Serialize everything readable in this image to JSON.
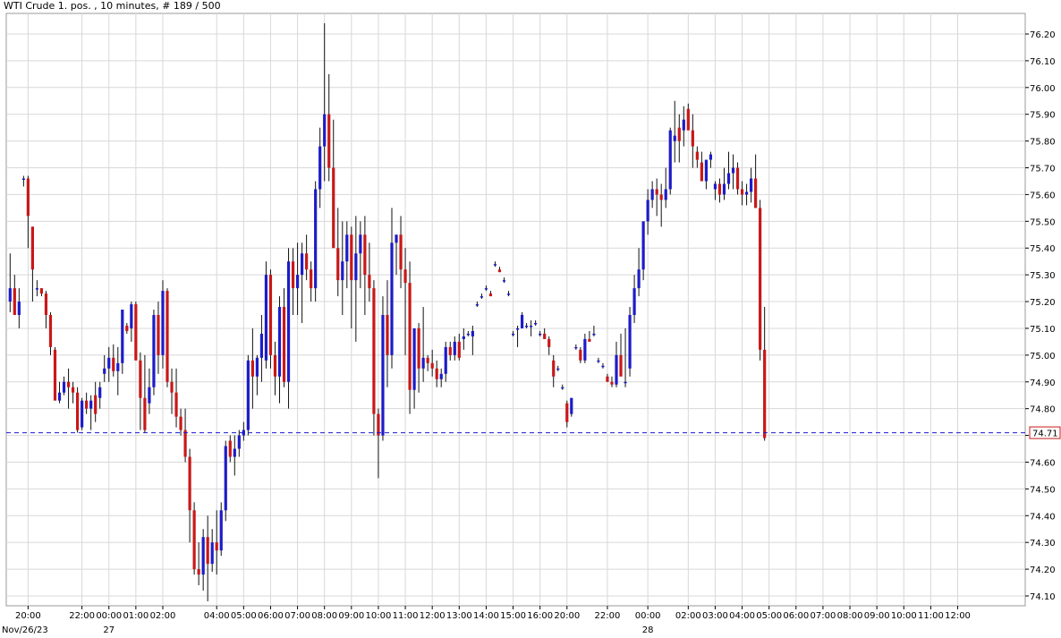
{
  "title": "WTI Crude 1. pos. , 10 minutes, # 189 / 500",
  "colors": {
    "up": "#1c1cc8",
    "down": "#c81818",
    "grid": "#d8d8d8",
    "current_line": "#1a1ad0"
  },
  "chart_data": {
    "type": "candlestick",
    "instrument": "WTI Crude 1. pos.",
    "interval": "10 minutes",
    "y_ticks": [
      74.1,
      74.2,
      74.3,
      74.4,
      74.5,
      74.6,
      74.7,
      74.8,
      74.9,
      75.0,
      75.1,
      75.2,
      75.3,
      75.4,
      75.5,
      75.6,
      75.7,
      75.8,
      75.9,
      76.0,
      76.1,
      76.2
    ],
    "y_tick_labels": [
      "74.10",
      "74.20",
      "74.30",
      "74.40",
      "74.50",
      "74.60",
      "74.70",
      "74.80",
      "74.90",
      "75.00",
      "75.10",
      "75.20",
      "75.30",
      "75.40",
      "75.50",
      "75.60",
      "75.70",
      "75.80",
      "75.90",
      "76.00",
      "76.10",
      "76.20"
    ],
    "ylim": [
      74.06,
      76.28
    ],
    "current_price": 74.71,
    "current_price_label": "74.71",
    "x_ticks": [
      {
        "i": 4,
        "label": "20:00"
      },
      {
        "i": 16,
        "label": "22:00"
      },
      {
        "i": 22,
        "label": "00:00"
      },
      {
        "i": 28,
        "label": "01:00"
      },
      {
        "i": 34,
        "label": "02:00"
      },
      {
        "i": 46,
        "label": "04:00"
      },
      {
        "i": 52,
        "label": "05:00"
      },
      {
        "i": 58,
        "label": "06:00"
      },
      {
        "i": 64,
        "label": "07:00"
      },
      {
        "i": 70,
        "label": "08:00"
      },
      {
        "i": 76,
        "label": "09:00"
      },
      {
        "i": 82,
        "label": "10:00"
      },
      {
        "i": 88,
        "label": "11:00"
      },
      {
        "i": 94,
        "label": "12:00"
      },
      {
        "i": 100,
        "label": "13:00"
      },
      {
        "i": 106,
        "label": "14:00"
      },
      {
        "i": 112,
        "label": "15:00"
      },
      {
        "i": 118,
        "label": "16:00"
      },
      {
        "i": 124,
        "label": "20:00"
      },
      {
        "i": 133,
        "label": "22:00"
      },
      {
        "i": 142,
        "label": "00:00"
      },
      {
        "i": 151,
        "label": "02:00"
      },
      {
        "i": 157,
        "label": "03:00"
      },
      {
        "i": 163,
        "label": "04:00"
      },
      {
        "i": 169,
        "label": "05:00"
      },
      {
        "i": 175,
        "label": "06:00"
      },
      {
        "i": 181,
        "label": "07:00"
      },
      {
        "i": 187,
        "label": "08:00"
      },
      {
        "i": 193,
        "label": "09:00"
      },
      {
        "i": 199,
        "label": "10:00"
      },
      {
        "i": 205,
        "label": "11:00"
      },
      {
        "i": 211,
        "label": "12:00"
      }
    ],
    "date_labels": [
      {
        "i": 0,
        "label": "Nov/26/23"
      },
      {
        "i": 22,
        "label": "27"
      },
      {
        "i": 142,
        "label": "28"
      }
    ],
    "ohlc": [
      [
        75.2,
        75.38,
        75.16,
        75.25
      ],
      [
        75.25,
        75.3,
        75.15,
        75.15
      ],
      [
        75.15,
        75.25,
        75.1,
        75.2
      ],
      [
        75.66,
        75.67,
        75.63,
        75.66
      ],
      [
        75.66,
        75.67,
        75.4,
        75.52
      ],
      [
        75.48,
        75.48,
        75.2,
        75.32
      ],
      [
        75.25,
        75.28,
        75.22,
        75.25
      ],
      [
        75.25,
        75.25,
        75.22,
        75.23
      ],
      [
        75.23,
        75.24,
        75.1,
        75.15
      ],
      [
        75.15,
        75.16,
        75.0,
        75.03
      ],
      [
        75.02,
        75.03,
        74.87,
        74.83
      ],
      [
        74.83,
        74.9,
        74.82,
        74.86
      ],
      [
        74.86,
        74.92,
        74.85,
        74.9
      ],
      [
        74.9,
        74.95,
        74.8,
        74.88
      ],
      [
        74.88,
        74.9,
        74.82,
        74.86
      ],
      [
        74.86,
        74.88,
        74.71,
        74.72
      ],
      [
        74.73,
        74.84,
        74.72,
        74.83
      ],
      [
        74.83,
        74.86,
        74.78,
        74.8
      ],
      [
        74.8,
        74.85,
        74.72,
        74.83
      ],
      [
        74.85,
        74.9,
        74.75,
        74.78
      ],
      [
        74.84,
        74.9,
        74.8,
        74.88
      ],
      [
        74.93,
        75.0,
        74.9,
        74.95
      ],
      [
        74.95,
        75.03,
        74.9,
        74.99
      ],
      [
        74.99,
        75.04,
        74.92,
        74.94
      ],
      [
        74.94,
        75.03,
        74.85,
        74.97
      ],
      [
        74.97,
        75.17,
        74.93,
        75.17
      ],
      [
        75.11,
        75.12,
        75.08,
        75.09
      ],
      [
        75.1,
        75.2,
        75.05,
        75.19
      ],
      [
        75.19,
        75.2,
        75.0,
        74.98
      ],
      [
        74.98,
        75.01,
        74.72,
        74.84
      ],
      [
        74.84,
        75.0,
        74.71,
        74.72
      ],
      [
        74.82,
        74.95,
        74.78,
        74.88
      ],
      [
        74.88,
        75.17,
        74.85,
        75.15
      ],
      [
        75.15,
        75.2,
        74.93,
        75.0
      ],
      [
        75.0,
        75.28,
        74.95,
        75.24
      ],
      [
        75.24,
        75.25,
        74.88,
        74.9
      ],
      [
        74.9,
        74.95,
        74.78,
        74.86
      ],
      [
        74.86,
        74.95,
        74.73,
        74.77
      ],
      [
        74.77,
        74.8,
        74.7,
        74.72
      ],
      [
        74.72,
        74.8,
        74.6,
        74.62
      ],
      [
        74.62,
        74.65,
        74.3,
        74.42
      ],
      [
        74.42,
        74.45,
        74.18,
        74.2
      ],
      [
        74.2,
        74.3,
        74.14,
        74.18
      ],
      [
        74.18,
        74.35,
        74.12,
        74.32
      ],
      [
        74.32,
        74.4,
        74.08,
        74.22
      ],
      [
        74.22,
        74.35,
        74.19,
        74.3
      ],
      [
        74.3,
        74.42,
        74.18,
        74.27
      ],
      [
        74.27,
        74.45,
        74.25,
        74.42
      ],
      [
        74.42,
        74.68,
        74.38,
        74.66
      ],
      [
        74.68,
        74.7,
        74.6,
        74.62
      ],
      [
        74.62,
        74.7,
        74.55,
        74.65
      ],
      [
        74.65,
        74.72,
        74.62,
        74.7
      ],
      [
        74.7,
        74.75,
        74.68,
        74.72
      ],
      [
        74.72,
        75.0,
        74.7,
        74.98
      ],
      [
        74.98,
        75.1,
        74.8,
        74.92
      ],
      [
        74.92,
        75.0,
        74.85,
        74.99
      ],
      [
        74.99,
        75.15,
        74.9,
        75.08
      ],
      [
        74.98,
        75.35,
        74.95,
        75.3
      ],
      [
        75.3,
        75.32,
        74.95,
        75.0
      ],
      [
        75.0,
        75.05,
        74.85,
        74.92
      ],
      [
        74.92,
        75.22,
        74.82,
        75.18
      ],
      [
        75.18,
        75.25,
        74.88,
        74.9
      ],
      [
        74.9,
        75.4,
        74.8,
        75.35
      ],
      [
        75.35,
        75.4,
        75.15,
        75.25
      ],
      [
        75.25,
        75.42,
        75.15,
        75.3
      ],
      [
        75.3,
        75.42,
        75.12,
        75.38
      ],
      [
        75.38,
        75.45,
        75.28,
        75.32
      ],
      [
        75.32,
        75.35,
        75.2,
        75.25
      ],
      [
        75.25,
        75.65,
        75.2,
        75.62
      ],
      [
        75.62,
        75.85,
        75.55,
        75.78
      ],
      [
        75.78,
        76.24,
        75.65,
        75.9
      ],
      [
        75.9,
        76.05,
        75.65,
        75.7
      ],
      [
        75.7,
        75.88,
        75.45,
        75.4
      ],
      [
        75.4,
        75.55,
        75.22,
        75.28
      ],
      [
        75.28,
        75.5,
        75.15,
        75.35
      ],
      [
        75.35,
        75.5,
        75.25,
        75.45
      ],
      [
        75.45,
        75.48,
        75.1,
        75.28
      ],
      [
        75.28,
        75.52,
        75.05,
        75.38
      ],
      [
        75.38,
        75.5,
        75.25,
        75.45
      ],
      [
        75.45,
        75.52,
        75.15,
        75.3
      ],
      [
        75.3,
        75.42,
        75.2,
        75.25
      ],
      [
        75.25,
        75.28,
        74.7,
        74.78
      ],
      [
        74.78,
        74.8,
        74.54,
        74.7
      ],
      [
        74.7,
        75.22,
        74.68,
        75.15
      ],
      [
        75.15,
        75.28,
        74.88,
        75.0
      ],
      [
        75.0,
        75.55,
        74.95,
        75.42
      ],
      [
        75.42,
        75.45,
        75.3,
        75.45
      ],
      [
        75.45,
        75.52,
        75.25,
        75.32
      ],
      [
        75.32,
        75.4,
        75.0,
        75.27
      ],
      [
        75.27,
        75.35,
        74.78,
        74.87
      ],
      [
        74.87,
        75.1,
        74.8,
        75.1
      ],
      [
        75.1,
        75.12,
        74.86,
        74.95
      ],
      [
        74.95,
        75.18,
        74.9,
        74.99
      ],
      [
        74.99,
        75.0,
        74.94,
        74.97
      ],
      [
        74.97,
        75.02,
        74.92,
        74.95
      ],
      [
        74.95,
        74.98,
        74.88,
        74.91
      ],
      [
        74.91,
        74.95,
        74.88,
        74.93
      ],
      [
        74.93,
        75.05,
        74.9,
        75.03
      ],
      [
        75.03,
        75.05,
        74.98,
        75.0
      ],
      [
        75.0,
        75.07,
        74.98,
        75.05
      ],
      [
        75.05,
        75.08,
        74.98,
        74.99
      ],
      [
        75.06,
        75.1,
        75.02,
        75.07
      ],
      [
        75.08,
        75.09,
        75.07,
        75.08
      ],
      [
        75.07,
        75.11,
        75.0,
        75.09
      ],
      [
        75.19,
        75.2,
        75.18,
        75.19
      ],
      [
        75.22,
        75.23,
        75.21,
        75.22
      ],
      [
        75.25,
        75.26,
        75.24,
        75.25
      ],
      [
        75.23,
        75.24,
        75.22,
        75.22
      ],
      [
        75.34,
        75.35,
        75.33,
        75.34
      ],
      [
        75.32,
        75.33,
        75.31,
        75.31
      ],
      [
        75.28,
        75.29,
        75.27,
        75.28
      ],
      [
        75.23,
        75.24,
        75.22,
        75.23
      ],
      [
        75.08,
        75.09,
        75.07,
        75.08
      ],
      [
        75.1,
        75.11,
        75.03,
        75.1
      ],
      [
        75.1,
        75.16,
        75.12,
        75.15
      ],
      [
        75.11,
        75.12,
        75.1,
        75.11
      ],
      [
        75.11,
        75.13,
        75.07,
        75.11
      ],
      [
        75.12,
        75.13,
        75.11,
        75.12
      ],
      [
        75.08,
        75.09,
        75.07,
        75.08
      ],
      [
        75.08,
        75.1,
        75.06,
        75.06
      ],
      [
        75.06,
        75.07,
        75.0,
        75.03
      ],
      [
        74.98,
        75.0,
        74.88,
        74.92
      ],
      [
        74.95,
        74.96,
        74.94,
        74.95
      ],
      [
        74.88,
        74.89,
        74.87,
        74.88
      ],
      [
        74.82,
        74.83,
        74.73,
        74.75
      ],
      [
        74.78,
        74.84,
        74.77,
        74.84
      ],
      [
        75.03,
        75.04,
        75.02,
        75.03
      ],
      [
        75.02,
        75.03,
        74.97,
        74.98
      ],
      [
        74.98,
        75.08,
        74.97,
        75.06
      ],
      [
        75.06,
        75.09,
        75.05,
        75.05
      ],
      [
        75.08,
        75.11,
        75.07,
        75.08
      ],
      [
        74.98,
        74.99,
        74.97,
        74.98
      ],
      [
        74.96,
        74.97,
        74.95,
        74.96
      ],
      [
        74.92,
        74.93,
        74.9,
        74.9
      ],
      [
        74.9,
        74.92,
        74.88,
        74.89
      ],
      [
        74.89,
        75.05,
        74.88,
        75.0
      ],
      [
        75.0,
        75.08,
        74.96,
        74.92
      ],
      [
        74.9,
        75.1,
        74.88,
        74.9
      ],
      [
        74.95,
        75.18,
        74.92,
        75.15
      ],
      [
        75.15,
        75.3,
        75.12,
        75.25
      ],
      [
        75.25,
        75.4,
        75.22,
        75.32
      ],
      [
        75.32,
        75.5,
        75.28,
        75.5
      ],
      [
        75.5,
        75.62,
        75.45,
        75.58
      ],
      [
        75.58,
        75.65,
        75.55,
        75.62
      ],
      [
        75.62,
        75.66,
        75.52,
        75.6
      ],
      [
        75.6,
        75.64,
        75.48,
        75.58
      ],
      [
        75.58,
        75.7,
        75.55,
        75.62
      ],
      [
        75.62,
        75.85,
        75.6,
        75.84
      ],
      [
        75.8,
        75.95,
        75.72,
        75.82
      ],
      [
        75.85,
        75.9,
        75.72,
        75.8
      ],
      [
        75.84,
        75.93,
        75.78,
        75.88
      ],
      [
        75.92,
        75.94,
        75.9,
        75.84
      ],
      [
        75.84,
        75.9,
        75.7,
        75.78
      ],
      [
        75.76,
        75.78,
        75.7,
        75.73
      ],
      [
        75.72,
        75.76,
        75.65,
        75.65
      ],
      [
        75.65,
        75.7,
        75.62,
        75.73
      ],
      [
        75.73,
        75.76,
        75.7,
        75.75
      ],
      [
        75.62,
        75.65,
        75.58,
        75.64
      ],
      [
        75.64,
        75.66,
        75.57,
        75.6
      ],
      [
        75.6,
        75.7,
        75.58,
        75.64
      ],
      [
        75.64,
        75.76,
        75.62,
        75.68
      ],
      [
        75.68,
        75.75,
        75.62,
        75.7
      ],
      [
        75.7,
        75.72,
        75.6,
        75.62
      ],
      [
        75.62,
        75.65,
        75.56,
        75.6
      ],
      [
        75.6,
        75.64,
        75.56,
        75.61
      ],
      [
        75.61,
        75.7,
        75.57,
        75.66
      ],
      [
        75.66,
        75.75,
        75.55,
        75.55
      ],
      [
        75.55,
        75.58,
        74.98,
        75.02
      ],
      [
        75.02,
        75.18,
        74.68,
        74.69
      ]
    ]
  }
}
